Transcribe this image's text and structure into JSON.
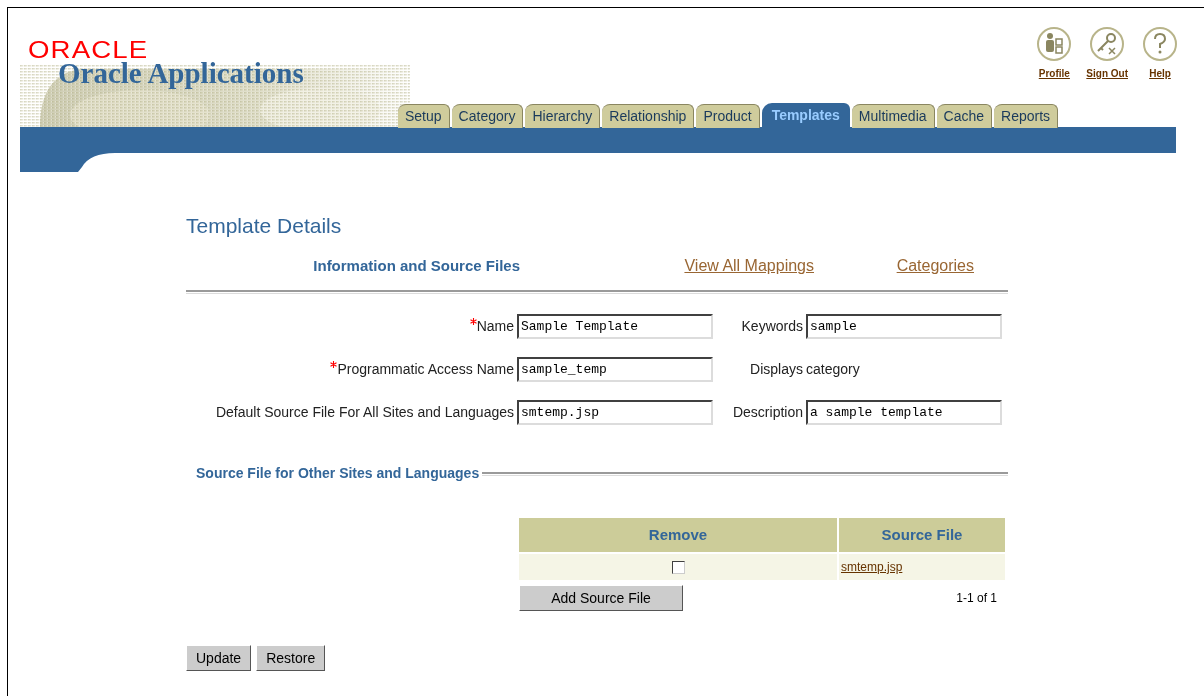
{
  "branding": {
    "logo": "ORACLE",
    "product": "Oracle Applications"
  },
  "global_links": [
    {
      "kind": "profile",
      "label": "Profile"
    },
    {
      "kind": "sign_out",
      "label": "Sign Out"
    },
    {
      "kind": "help",
      "label": "Help"
    }
  ],
  "tabs": [
    {
      "label": "Setup",
      "selected": false
    },
    {
      "label": "Category",
      "selected": false
    },
    {
      "label": "Hierarchy",
      "selected": false
    },
    {
      "label": "Relationship",
      "selected": false
    },
    {
      "label": "Product",
      "selected": false
    },
    {
      "label": "Templates",
      "selected": true
    },
    {
      "label": "Multimedia",
      "selected": false
    },
    {
      "label": "Cache",
      "selected": false
    },
    {
      "label": "Reports",
      "selected": false
    }
  ],
  "page_title": "Template Details",
  "sub_tabs": [
    {
      "label": "Information and Source Files",
      "selected": true
    },
    {
      "label": "View All Mappings",
      "selected": false
    },
    {
      "label": "Categories",
      "selected": false
    }
  ],
  "form": {
    "rows": [
      {
        "left": {
          "label": "Name",
          "required": true,
          "kind": "input",
          "value": "Sample Template"
        },
        "right": {
          "label": "Keywords",
          "required": false,
          "kind": "input",
          "value": "sample"
        }
      },
      {
        "left": {
          "label": "Programmatic Access Name",
          "required": true,
          "kind": "input",
          "value": "sample_temp"
        },
        "right": {
          "label": "Displays",
          "required": false,
          "kind": "text",
          "value": "category"
        }
      },
      {
        "left": {
          "label": "Default Source File For All Sites and Languages",
          "required": false,
          "kind": "input",
          "value": "smtemp.jsp"
        },
        "right": {
          "label": "Description",
          "required": false,
          "kind": "input",
          "value": "a sample template"
        }
      }
    ]
  },
  "section_title": "Source File for Other Sites and Languages",
  "table": {
    "columns": [
      "Remove",
      "Source File"
    ],
    "rows": [
      {
        "checked": false,
        "source_file": "smtemp.jsp"
      }
    ],
    "add_button": "Add Source File",
    "pagination": "1-1 of 1"
  },
  "buttons": [
    "Update",
    "Restore"
  ]
}
